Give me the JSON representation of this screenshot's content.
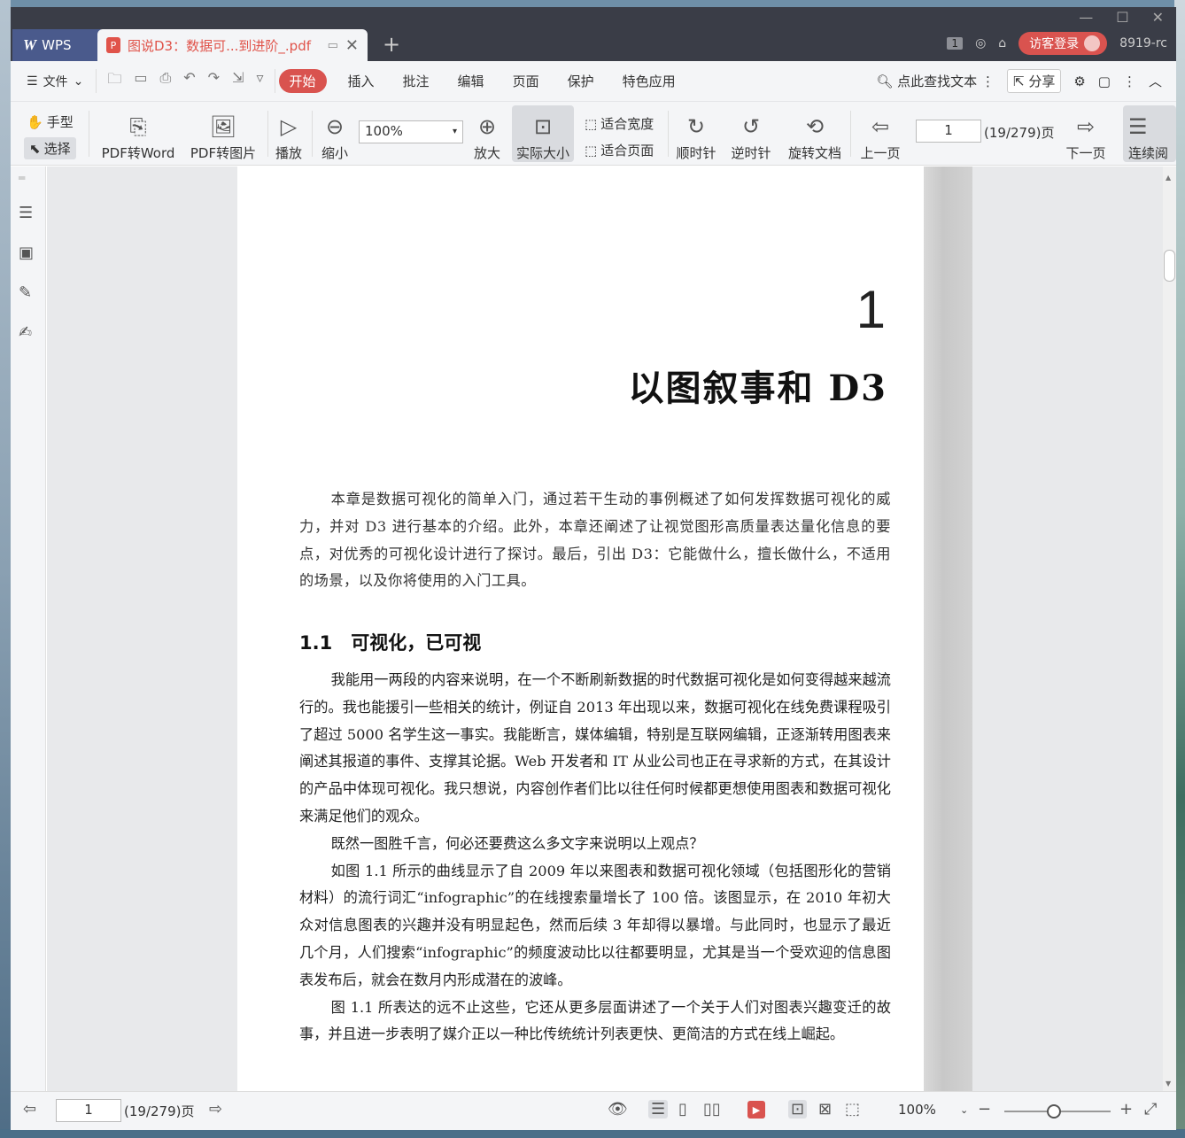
{
  "titlebar": {
    "app_tab": "WPS",
    "app_logo": "W",
    "doc_tab": "图说D3：数据可...到进阶_.pdf",
    "badge": "1",
    "login": "访客登录",
    "user_code": "8919-rc"
  },
  "menu": {
    "file": "文件",
    "items": [
      "开始",
      "插入",
      "批注",
      "编辑",
      "页面",
      "保护",
      "特色应用"
    ],
    "search": "点此查找文本",
    "share": "分享"
  },
  "ribbon": {
    "hand": "手型",
    "select": "选择",
    "pdf2word": "PDF转Word",
    "pdf2img": "PDF转图片",
    "play": "播放",
    "zoom_out": "缩小",
    "zoom_value": "100%",
    "zoom_in": "放大",
    "actual_size": "实际大小",
    "fit_width": "适合宽度",
    "fit_page": "适合页面",
    "clockwise": "顺时针",
    "counter": "逆时针",
    "rotate_doc": "旋转文档",
    "prev_page": "上一页",
    "page_value": "1",
    "page_total": "(19/279)页",
    "next_page": "下一页",
    "continuous": "连续阅"
  },
  "document": {
    "chapter_num": "1",
    "chapter_title": "以图叙事和 D3",
    "intro": "本章是数据可视化的简单入门，通过若干生动的事例概述了如何发挥数据可视化的威力，并对 D3 进行基本的介绍。此外，本章还阐述了让视觉图形高质量表达量化信息的要点，对优秀的可视化设计进行了探讨。最后，引出 D3：它能做什么，擅长做什么，不适用的场景，以及你将使用的入门工具。",
    "section": "1.1　可视化，已可视",
    "paragraphs": [
      "我能用一两段的内容来说明，在一个不断刷新数据的时代数据可视化是如何变得越来越流行的。我也能援引一些相关的统计，例证自 2013 年出现以来，数据可视化在线免费课程吸引了超过 5000 名学生这一事实。我能断言，媒体编辑，特别是互联网编辑，正逐渐转用图表来阐述其报道的事件、支撑其论据。Web 开发者和 IT 从业公司也正在寻求新的方式，在其设计的产品中体现可视化。我只想说，内容创作者们比以往任何时候都更想使用图表和数据可视化来满足他们的观众。",
      "既然一图胜千言，何必还要费这么多文字来说明以上观点？",
      "如图 1.1 所示的曲线显示了自 2009 年以来图表和数据可视化领域（包括图形化的营销材料）的流行词汇“infographic”的在线搜索量增长了 100 倍。该图显示，在 2010 年初大众对信息图表的兴趣并没有明显起色，然而后续 3 年却得以暴增。与此同时，也显示了最近几个月，人们搜索“infographic”的频度波动比以往都要明显，尤其是当一个受欢迎的信息图表发布后，就会在数月内形成潜在的波峰。",
      "图 1.1 所表达的远不止这些，它还从更多层面讲述了一个关于人们对图表兴趣变迁的故事，并且进一步表明了媒介正以一种比传统统计列表更快、更简洁的方式在线上崛起。"
    ]
  },
  "status": {
    "page_value": "1",
    "page_total": "(19/279)页",
    "zoom": "100%"
  },
  "colors": {
    "accent": "#d9534f",
    "titlebar": "#3a3d47",
    "toolbar": "#f4f5f7"
  }
}
